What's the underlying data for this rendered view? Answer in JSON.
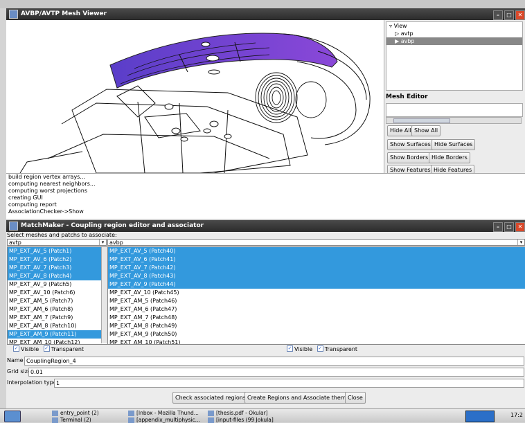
{
  "viewer": {
    "title": "AVBP/AVTP Mesh Viewer",
    "tree": {
      "root": "View",
      "items": [
        "avtp",
        "avbp"
      ]
    },
    "mesh_editor_label": "Mesh Editor",
    "buttons": {
      "hide_all": "Hide All",
      "show_all": "Show All",
      "show_surfaces": "Show Surfaces",
      "hide_surfaces": "Hide Surfaces",
      "show_borders": "Show Borders",
      "hide_borders": "Hide Borders",
      "show_features": "Show Features",
      "hide_features": "Hide Features"
    },
    "log": [
      "build region vertex arrays...",
      "computing nearest neighbors...",
      "computing worst projections",
      "creating GUI",
      "computing report",
      "AssociationChecker->Show"
    ]
  },
  "matchmaker": {
    "title": "MatchMaker - Coupling region editor and associator",
    "select_label": "Select meshes and patchs to associate:",
    "left_mesh": "avtp",
    "right_mesh": "avbp",
    "left_list": [
      {
        "label": "MP_EXT_AV_5 (Patch1)",
        "selected": true
      },
      {
        "label": "MP_EXT_AV_6 (Patch2)",
        "selected": true
      },
      {
        "label": "MP_EXT_AV_7 (Patch3)",
        "selected": true
      },
      {
        "label": "MP_EXT_AV_8 (Patch4)",
        "selected": true
      },
      {
        "label": "MP_EXT_AV_9 (Patch5)",
        "selected": false
      },
      {
        "label": "MP_EXT_AV_10 (Patch6)",
        "selected": false
      },
      {
        "label": "MP_EXT_AM_5 (Patch7)",
        "selected": false
      },
      {
        "label": "MP_EXT_AM_6 (Patch8)",
        "selected": false
      },
      {
        "label": "MP_EXT_AM_7 (Patch9)",
        "selected": false
      },
      {
        "label": "MP_EXT_AM_8 (Patch10)",
        "selected": false
      },
      {
        "label": "MP_EXT_AM_9 (Patch11)",
        "selected": true
      },
      {
        "label": "MP_EXT_AM_10 (Patch12)",
        "selected": false
      }
    ],
    "right_list": [
      {
        "label": "MP_EXT_AV_5 (Patch40)",
        "selected": true
      },
      {
        "label": "MP_EXT_AV_6 (Patch41)",
        "selected": true
      },
      {
        "label": "MP_EXT_AV_7 (Patch42)",
        "selected": true
      },
      {
        "label": "MP_EXT_AV_8 (Patch43)",
        "selected": true
      },
      {
        "label": "MP_EXT_AV_9 (Patch44)",
        "selected": true
      },
      {
        "label": "MP_EXT_AV_10 (Patch45)",
        "selected": false
      },
      {
        "label": "MP_EXT_AM_5 (Patch46)",
        "selected": false
      },
      {
        "label": "MP_EXT_AM_6 (Patch47)",
        "selected": false
      },
      {
        "label": "MP_EXT_AM_7 (Patch48)",
        "selected": false
      },
      {
        "label": "MP_EXT_AM_8 (Patch49)",
        "selected": false
      },
      {
        "label": "MP_EXT_AM_9 (Patch50)",
        "selected": false
      },
      {
        "label": "MP_EXT_AM_10 (Patch51)",
        "selected": false
      }
    ],
    "visible_label": "Visible",
    "transparent_label": "Transparent",
    "name_label": "Name",
    "name_value": "CouplingRegion_4",
    "grid_label": "Grid size",
    "grid_value": "0.01",
    "interp_label": "Interpolation type",
    "interp_value": "1",
    "check_btn": "Check associated regions",
    "create_btn": "Create Regions and Associate them",
    "close_btn": "Close"
  },
  "taskbar": {
    "tasks": [
      "entry_point (2)",
      "Terminal (2)",
      "[Inbox - Mozilla Thund...",
      "[appendix_multiphysic...",
      "[thesis.pdf - Okular]",
      "[input-files (99 Jokula]"
    ],
    "clock": "17:2"
  },
  "colors": {
    "selection": "#3399dd",
    "mesh_purple": "#6a40d0",
    "titlebar": "#2b2b2b"
  }
}
